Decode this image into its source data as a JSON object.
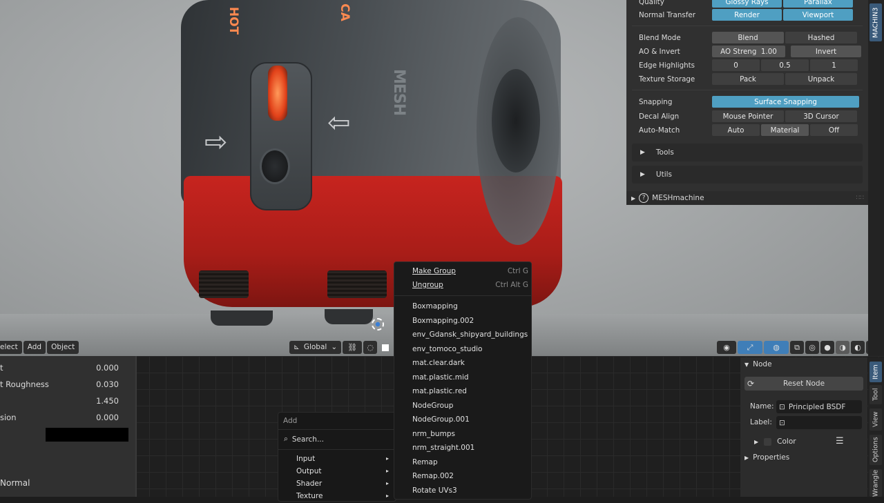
{
  "viewport": {
    "mode_menu": [
      "elect",
      "Add",
      "Object"
    ],
    "transform_orientation": "Global",
    "header_icons": [
      "viewport-cursor-icon",
      "gizmo-icon",
      "overlay-icon",
      "xray-icon",
      "wireframe-icon",
      "solid-icon",
      "material-icon",
      "rendered-icon"
    ]
  },
  "model": {
    "label_top": "CA",
    "label_left": "HOT",
    "mesh_text": "MESH"
  },
  "machin3_panel": {
    "tab": "MACHIN3",
    "rows": [
      {
        "label": "Quality",
        "cells": [
          "Glossy Rays",
          "Parallax"
        ]
      },
      {
        "label": "Normal Transfer",
        "cells": [
          "Render",
          "Viewport"
        ]
      },
      {
        "label": "Blend Mode",
        "cells": [
          "Blend",
          "Hashed"
        ]
      },
      {
        "label": "AO & Invert",
        "cells": [
          "AO Streng  1.00",
          "Invert"
        ]
      },
      {
        "label": "Edge Highlights",
        "cells": [
          "0",
          "0.5",
          "1"
        ]
      },
      {
        "label": "Texture Storage",
        "cells": [
          "Pack",
          "Unpack"
        ]
      },
      {
        "label": "Snapping",
        "cells": [
          "Surface Snapping"
        ]
      },
      {
        "label": "Decal Align",
        "cells": [
          "Mouse Pointer",
          "3D Cursor"
        ]
      },
      {
        "label": "Auto-Match",
        "cells": [
          "Auto",
          "Material",
          "Off"
        ]
      }
    ],
    "tools": "Tools",
    "utils": "Utils",
    "meshmachine": "MESHmachine"
  },
  "node_props": {
    "rows": [
      {
        "label": "t",
        "value": "0.000"
      },
      {
        "label": "t Roughness",
        "value": "0.030"
      },
      {
        "label": "",
        "value": "1.450"
      },
      {
        "label": "sion",
        "value": "0.000"
      }
    ],
    "normal": "Normal"
  },
  "add_menu": {
    "title": "Add",
    "search": "Search...",
    "items": [
      "Input",
      "Output",
      "Shader",
      "Texture"
    ]
  },
  "group_menu": {
    "top": [
      {
        "label": "Make Group",
        "shortcut": "Ctrl G"
      },
      {
        "label": "Ungroup",
        "shortcut": "Ctrl Alt G"
      }
    ],
    "groups": [
      "Boxmapping",
      "Boxmapping.002",
      "env_Gdansk_shipyard_buildings",
      "env_tomoco_studio",
      "mat.clear.dark",
      "mat.plastic.mid",
      "mat.plastic.red",
      "NodeGroup",
      "NodeGroup.001",
      "nrm_bumps",
      "nrm_straight.001",
      "Remap",
      "Remap.002",
      "Rotate UVs3"
    ]
  },
  "sidebar": {
    "section": "Node",
    "reset": "Reset Node",
    "name_label": "Name:",
    "name_value": "Principled BSDF",
    "label_label": "Label:",
    "label_value": "",
    "color": "Color",
    "properties": "Properties",
    "tabs": [
      "Item",
      "Tool",
      "View",
      "Options",
      "Wrangler"
    ]
  }
}
